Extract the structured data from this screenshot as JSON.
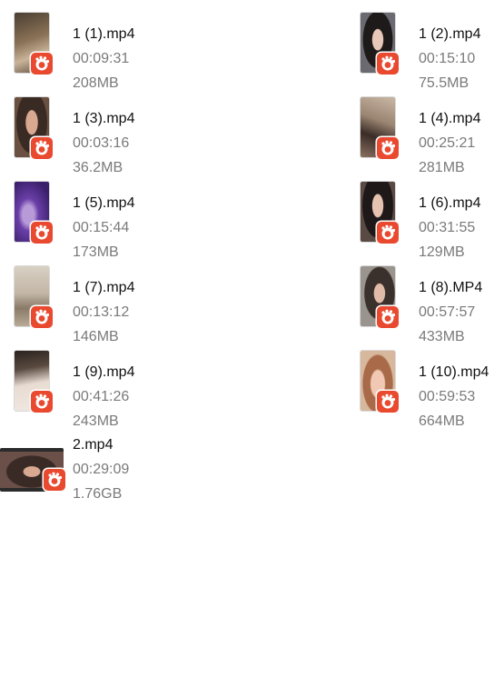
{
  "files": [
    {
      "name": "1 (1).mp4",
      "duration": "00:09:31",
      "size": "208MB",
      "thumb_color": "#6a5a48"
    },
    {
      "name": "1 (2).mp4",
      "duration": "00:15:10",
      "size": "75.5MB",
      "thumb_color": "#3a3a40"
    },
    {
      "name": "1 (3).mp4",
      "duration": "00:03:16",
      "size": "36.2MB",
      "thumb_color": "#5a3f36"
    },
    {
      "name": "1 (4).mp4",
      "duration": "00:25:21",
      "size": "281MB",
      "thumb_color": "#8c7a6a"
    },
    {
      "name": "1 (5).mp4",
      "duration": "00:15:44",
      "size": "173MB",
      "thumb_color": "#6a3fa8"
    },
    {
      "name": "1 (6).mp4",
      "duration": "00:31:55",
      "size": "129MB",
      "thumb_color": "#3a2f2c"
    },
    {
      "name": "1 (7).mp4",
      "duration": "00:13:12",
      "size": "146MB",
      "thumb_color": "#a89a86"
    },
    {
      "name": "1 (8).MP4",
      "duration": "00:57:57",
      "size": "433MB",
      "thumb_color": "#6d6660"
    },
    {
      "name": "1 (9).mp4",
      "duration": "00:41:26",
      "size": "243MB",
      "thumb_color": "#4a4038"
    },
    {
      "name": "1 (10).mp4",
      "duration": "00:59:53",
      "size": "664MB",
      "thumb_color": "#b98a6c"
    },
    {
      "name": "2.mp4",
      "duration": "00:29:09",
      "size": "1.76GB",
      "thumb_color": "#4a3a36"
    }
  ],
  "badge_color": "#e8492f",
  "badge_icon": "video-player-app-icon"
}
